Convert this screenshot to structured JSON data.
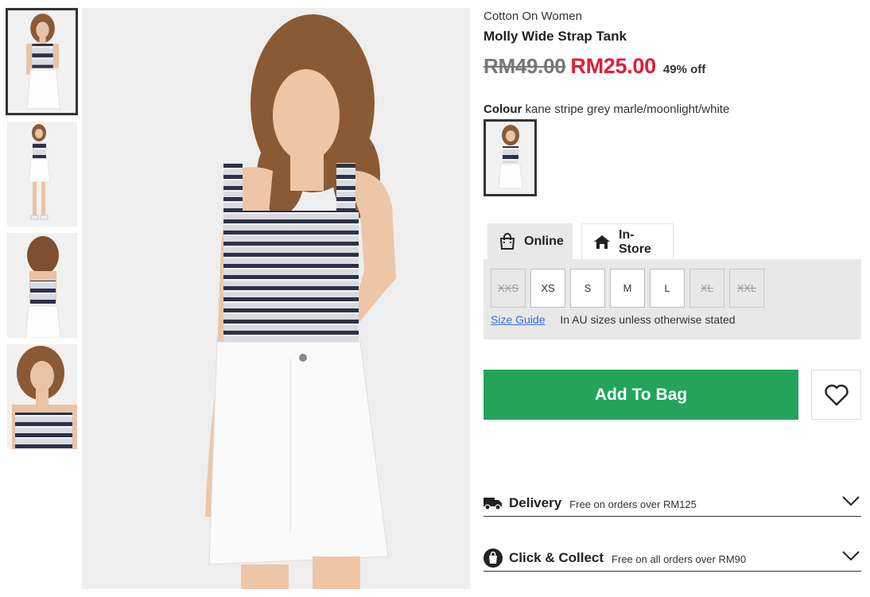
{
  "product": {
    "brand": "Cotton On Women",
    "name": "Molly Wide Strap Tank",
    "old_price": "RM49.00",
    "new_price": "RM25.00",
    "discount": "49% off"
  },
  "colour": {
    "label": "Colour",
    "value": "kane stripe grey marle/moonlight/white"
  },
  "tabs": [
    {
      "label": "Online",
      "icon": "shopping-bag-icon",
      "active": true
    },
    {
      "label": "In-Store",
      "icon": "store-icon",
      "active": false
    }
  ],
  "sizes": [
    {
      "label": "XXS",
      "available": false
    },
    {
      "label": "XS",
      "available": true
    },
    {
      "label": "S",
      "available": true
    },
    {
      "label": "M",
      "available": true
    },
    {
      "label": "L",
      "available": true
    },
    {
      "label": "XL",
      "available": false
    },
    {
      "label": "XXL",
      "available": false
    }
  ],
  "size_guide": {
    "link": "Size Guide",
    "note": "In AU sizes unless otherwise stated"
  },
  "actions": {
    "add_to_bag": "Add To Bag",
    "wishlist_icon": "heart-icon"
  },
  "accordions": {
    "delivery": {
      "title": "Delivery",
      "subtitle": "Free on orders over RM125",
      "icon": "truck-icon"
    },
    "collect": {
      "title": "Click & Collect",
      "subtitle": "Free on all orders over RM90",
      "icon": "bag-circle-icon"
    }
  },
  "colors": {
    "sale_red": "#e11d3a",
    "add_green": "#23a45a",
    "panel_grey": "#e8e8e8",
    "link_blue": "#3a6fd8"
  }
}
